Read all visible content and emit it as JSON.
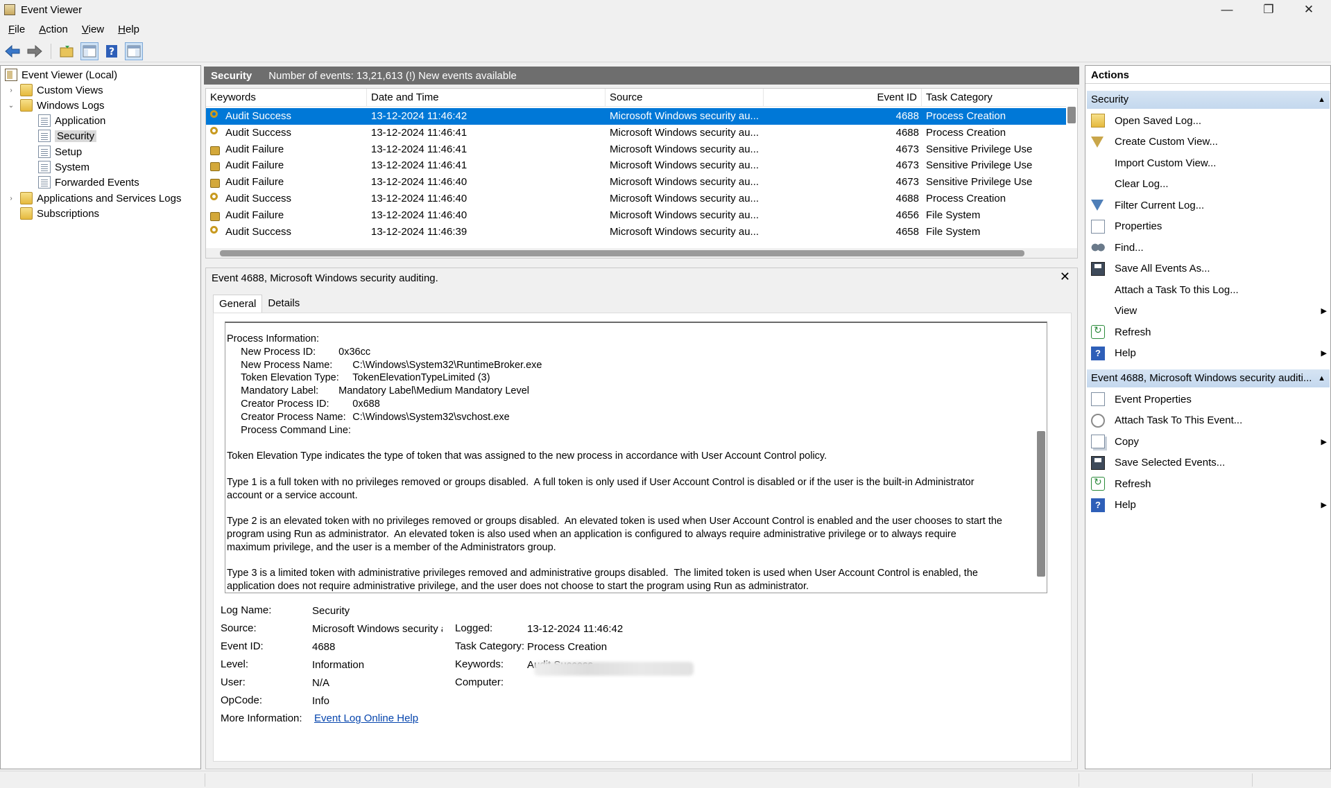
{
  "window": {
    "title": "Event Viewer",
    "controls": {
      "minimize": "—",
      "restore": "❐",
      "close": "✕"
    }
  },
  "menu": {
    "items": [
      {
        "mnemonic": "F",
        "rest": "ile"
      },
      {
        "mnemonic": "A",
        "rest": "ction"
      },
      {
        "mnemonic": "V",
        "rest": "iew"
      },
      {
        "mnemonic": "H",
        "rest": "elp"
      }
    ]
  },
  "toolbar": {
    "icons": [
      "back-arrow-icon",
      "forward-arrow-icon",
      "open-folder-icon",
      "show-hide-tree-icon",
      "help-icon",
      "show-hide-action-pane-icon"
    ],
    "colors": {
      "arrow": "#3a78c9",
      "help": "#2e5fb8"
    }
  },
  "tree": {
    "root": "Event Viewer (Local)",
    "items": [
      {
        "label": "Custom Views",
        "expander": "›"
      },
      {
        "label": "Windows Logs",
        "expander": "⌄"
      },
      {
        "label": "Application"
      },
      {
        "label": "Security",
        "selected": true
      },
      {
        "label": "Setup"
      },
      {
        "label": "System"
      },
      {
        "label": "Forwarded Events"
      },
      {
        "label": "Applications and Services Logs",
        "expander": "›"
      },
      {
        "label": "Subscriptions"
      }
    ]
  },
  "log_header": {
    "name": "Security",
    "summary": "Number of events: 13,21,613 (!) New events available"
  },
  "event_list": {
    "columns": [
      "Keywords",
      "Date and Time",
      "Source",
      "Event ID",
      "Task Category"
    ],
    "rows": [
      {
        "icon": "key-icon",
        "keywords": "Audit Success",
        "datetime": "13-12-2024 11:46:42",
        "source": "Microsoft Windows security au...",
        "event_id": "4688",
        "task": "Process Creation",
        "selected": true
      },
      {
        "icon": "key-icon",
        "keywords": "Audit Success",
        "datetime": "13-12-2024 11:46:41",
        "source": "Microsoft Windows security au...",
        "event_id": "4688",
        "task": "Process Creation"
      },
      {
        "icon": "lock-icon",
        "keywords": "Audit Failure",
        "datetime": "13-12-2024 11:46:41",
        "source": "Microsoft Windows security au...",
        "event_id": "4673",
        "task": "Sensitive Privilege Use"
      },
      {
        "icon": "lock-icon",
        "keywords": "Audit Failure",
        "datetime": "13-12-2024 11:46:41",
        "source": "Microsoft Windows security au...",
        "event_id": "4673",
        "task": "Sensitive Privilege Use"
      },
      {
        "icon": "lock-icon",
        "keywords": "Audit Failure",
        "datetime": "13-12-2024 11:46:40",
        "source": "Microsoft Windows security au...",
        "event_id": "4673",
        "task": "Sensitive Privilege Use"
      },
      {
        "icon": "key-icon",
        "keywords": "Audit Success",
        "datetime": "13-12-2024 11:46:40",
        "source": "Microsoft Windows security au...",
        "event_id": "4688",
        "task": "Process Creation"
      },
      {
        "icon": "lock-icon",
        "keywords": "Audit Failure",
        "datetime": "13-12-2024 11:46:40",
        "source": "Microsoft Windows security au...",
        "event_id": "4656",
        "task": "File System"
      },
      {
        "icon": "key-icon",
        "keywords": "Audit Success",
        "datetime": "13-12-2024 11:46:39",
        "source": "Microsoft Windows security au...",
        "event_id": "4658",
        "task": "File System"
      }
    ]
  },
  "detail": {
    "title": "Event 4688, Microsoft Windows security auditing.",
    "close": "✕",
    "tabs": [
      "General",
      "Details"
    ],
    "description": "Process Information:\n\tNew Process ID:\t\t0x36cc\n\tNew Process Name:\t\tC:\\Windows\\System32\\RuntimeBroker.exe\n\tToken Elevation Type:\tTokenElevationTypeLimited (3)\n\tMandatory Label:\t\tMandatory Label\\Medium Mandatory Level\n\tCreator Process ID:\t\t0x688\n\tCreator Process Name:\tC:\\Windows\\System32\\svchost.exe\n\tProcess Command Line:\t\n\nToken Elevation Type indicates the type of token that was assigned to the new process in accordance with User Account Control policy.\n\nType 1 is a full token with no privileges removed or groups disabled.  A full token is only used if User Account Control is disabled or if the user is the built-in Administrator\naccount or a service account.\n\nType 2 is an elevated token with no privileges removed or groups disabled.  An elevated token is used when User Account Control is enabled and the user chooses to start the\nprogram using Run as administrator.  An elevated token is also used when an application is configured to always require administrative privilege or to always require\nmaximum privilege, and the user is a member of the Administrators group.\n\nType 3 is a limited token with administrative privileges removed and administrative groups disabled.  The limited token is used when User Account Control is enabled, the\napplication does not require administrative privilege, and the user does not choose to start the program using Run as administrator.",
    "meta": {
      "log_name_label": "Log Name:",
      "log_name": "Security",
      "source_label": "Source:",
      "source": "Microsoft Windows security a",
      "logged_label": "Logged:",
      "logged": "13-12-2024 11:46:42",
      "event_id_label": "Event ID:",
      "event_id": "4688",
      "task_category_label": "Task Category:",
      "task_category": "Process Creation",
      "level_label": "Level:",
      "level": "Information",
      "keywords_label": "Keywords:",
      "keywords": "Audit Success",
      "user_label": "User:",
      "user": "N/A",
      "computer_label": "Computer:",
      "opcode_label": "OpCode:",
      "opcode": "Info",
      "more_info_label": "More Information:",
      "more_info_link": "Event Log Online Help"
    }
  },
  "actions": {
    "title": "Actions",
    "sections": [
      {
        "title": "Security",
        "items": [
          {
            "label": "Open Saved Log...",
            "icon": "open-folder-icon"
          },
          {
            "label": "Create Custom View...",
            "icon": "filter-icon"
          },
          {
            "label": "Import Custom View...",
            "icon": ""
          },
          {
            "label": "Clear Log...",
            "icon": ""
          },
          {
            "label": "Filter Current Log...",
            "icon": "filter-blue-icon"
          },
          {
            "label": "Properties",
            "icon": "properties-icon"
          },
          {
            "label": "Find...",
            "icon": "find-icon"
          },
          {
            "label": "Save All Events As...",
            "icon": "save-icon"
          },
          {
            "label": "Attach a Task To this Log...",
            "icon": ""
          },
          {
            "label": "View",
            "icon": "",
            "submenu": true
          },
          {
            "label": "Refresh",
            "icon": "refresh-icon"
          },
          {
            "label": "Help",
            "icon": "help-icon",
            "submenu": true
          }
        ]
      },
      {
        "title": "Event 4688, Microsoft Windows security auditi...",
        "items": [
          {
            "label": "Event Properties",
            "icon": "event-properties-icon"
          },
          {
            "label": "Attach Task To This Event...",
            "icon": "task-clock-icon"
          },
          {
            "label": "Copy",
            "icon": "copy-icon",
            "submenu": true
          },
          {
            "label": "Save Selected Events...",
            "icon": "save-icon"
          },
          {
            "label": "Refresh",
            "icon": "refresh-icon"
          },
          {
            "label": "Help",
            "icon": "help-icon",
            "submenu": true
          }
        ]
      }
    ],
    "collapse_glyph": "▲",
    "submenu_glyph": "▶"
  },
  "colors": {
    "selection": "#0078d7",
    "header_bar": "#6e6e6e",
    "action_section": "#c4d8ee",
    "link": "#0645ad"
  }
}
